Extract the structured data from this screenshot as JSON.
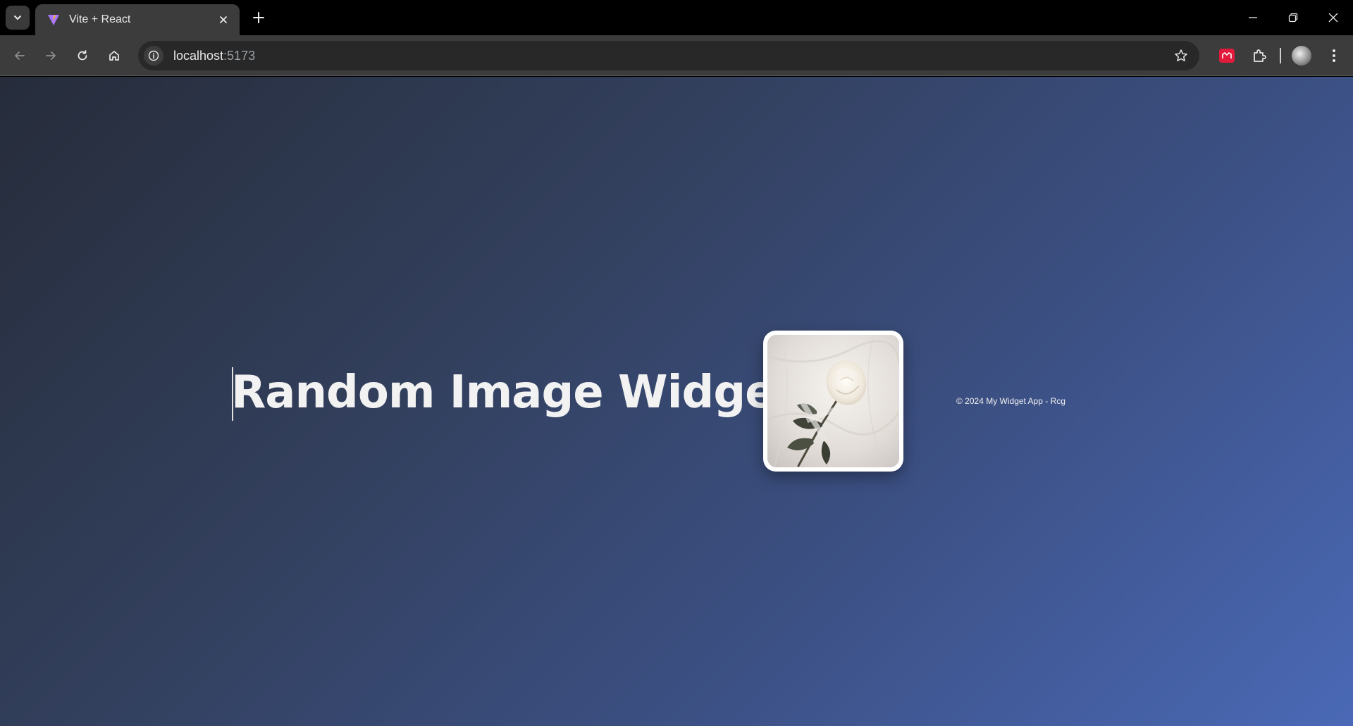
{
  "browser": {
    "tab_title": "Vite + React",
    "url_host": "localhost",
    "url_port": ":5173"
  },
  "icons": {
    "tab_search": "chevron-down-icon",
    "favicon": "vite-icon",
    "tab_close": "close-icon",
    "new_tab": "plus-icon",
    "minimize": "minimize-icon",
    "restore": "restore-icon",
    "close_window": "close-icon",
    "back": "arrow-left-icon",
    "forward": "arrow-right-icon",
    "reload": "reload-icon",
    "home": "home-icon",
    "site_info": "info-icon",
    "bookmark": "star-icon",
    "extension_red": "extension-icon",
    "extensions": "puzzle-icon",
    "profile": "avatar",
    "menu": "kebab-menu-icon"
  },
  "page": {
    "title": "Random Image Widget",
    "image_alt": "white rose on white sheets",
    "footer": "© 2024 My Widget App - Rcg"
  },
  "colors": {
    "bg_gradient_start": "#262c3a",
    "bg_gradient_end": "#4a69b6",
    "title_color": "#f2f2f2",
    "card_border": "#ffffff",
    "extension_red": "#e21b3c"
  }
}
